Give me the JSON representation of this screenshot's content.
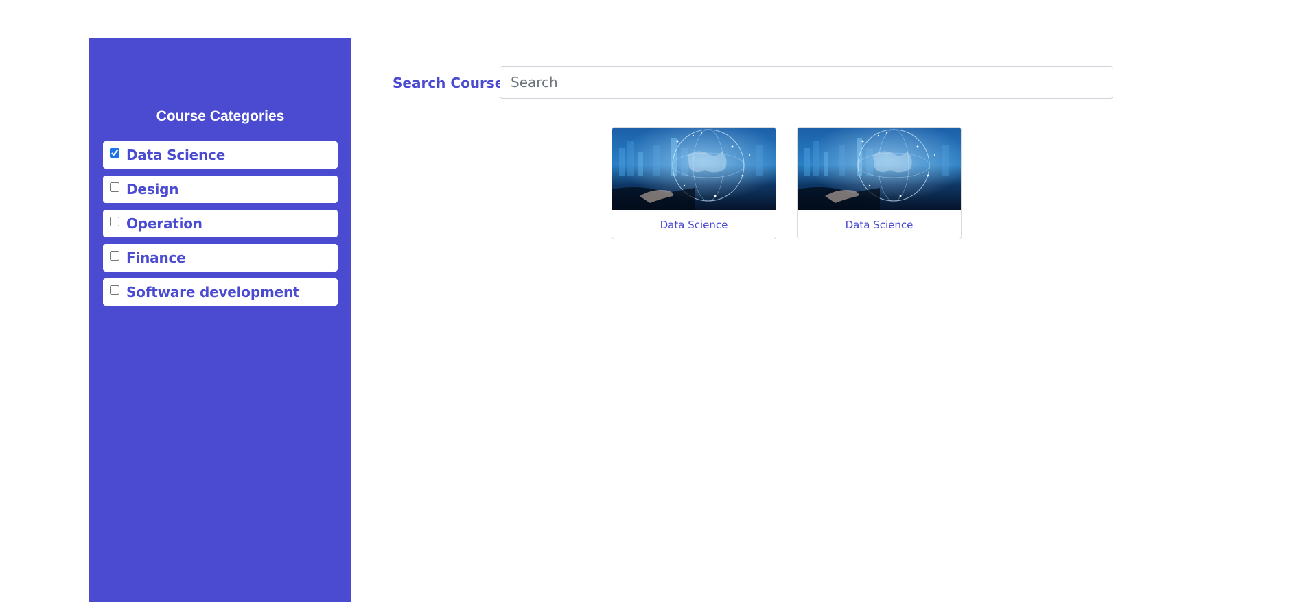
{
  "sidebar": {
    "title": "Course Categories",
    "categories": [
      {
        "label": "Data Science",
        "checked": true
      },
      {
        "label": "Design",
        "checked": false
      },
      {
        "label": "Operation",
        "checked": false
      },
      {
        "label": "Finance",
        "checked": false
      },
      {
        "label": "Software development",
        "checked": false
      }
    ]
  },
  "search": {
    "label": "Search Courses",
    "placeholder": "Search",
    "value": ""
  },
  "courses": [
    {
      "title": "Data Science",
      "image": "data-science-globe-image"
    },
    {
      "title": "Data Science",
      "image": "data-science-globe-image"
    }
  ],
  "colors": {
    "accent": "#4a4bd1",
    "checkbox": "#1a73e8"
  }
}
